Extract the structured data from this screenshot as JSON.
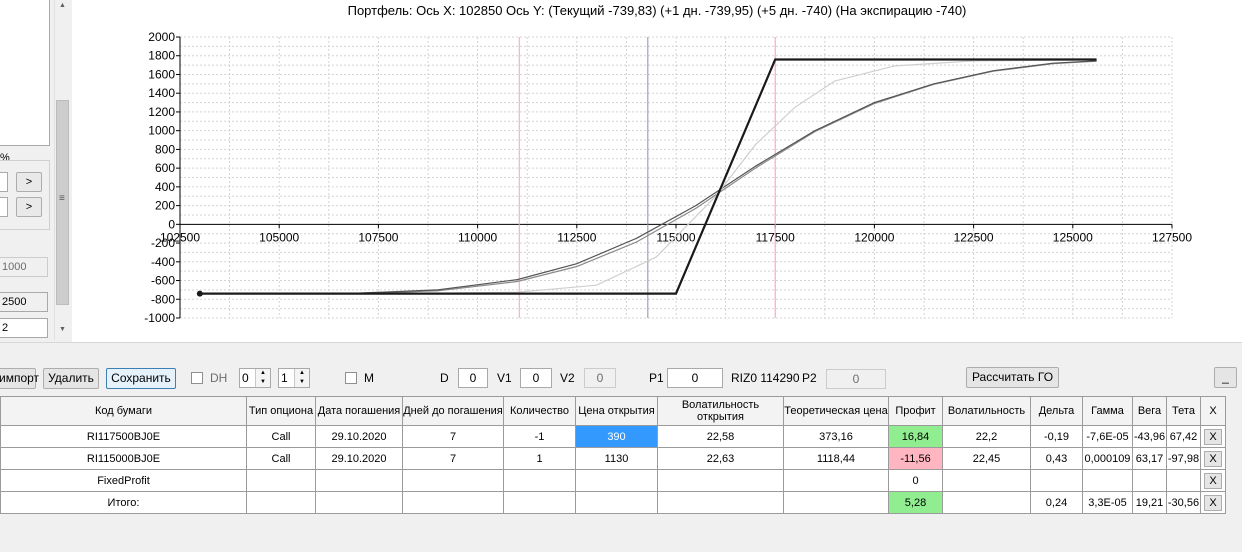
{
  "chart": {
    "title": "Портфель: Ось X: 102850 Ось Y:  (Текущий -739,83)  (+1 дн. -739,95)  (+5 дн. -740)  (На экспирацию -740)"
  },
  "chart_data": {
    "type": "line",
    "xlim": [
      102500,
      127500
    ],
    "ylim": [
      -1000,
      2000
    ],
    "x_ticks": [
      "102500",
      "105000",
      "107500",
      "110000",
      "112500",
      "115000",
      "117500",
      "120000",
      "122500",
      "125000",
      "127500"
    ],
    "y_ticks": [
      "2000",
      "1800",
      "1600",
      "1400",
      "1200",
      "1000",
      "800",
      "600",
      "400",
      "200",
      "0",
      "-200",
      "-400",
      "-600",
      "-800",
      "-1000"
    ],
    "grid": true,
    "vertical_lines": [
      {
        "x": 111050,
        "color": "#ff9fb0"
      },
      {
        "x": 114290,
        "color": "#8a8fa8"
      },
      {
        "x": 117500,
        "color": "#ff9fb0"
      }
    ],
    "series": [
      {
        "color": "#1a1a1a",
        "points": [
          [
            103000,
            -740
          ],
          [
            115000,
            -740
          ],
          [
            117500,
            1760
          ],
          [
            125600,
            1760
          ]
        ]
      },
      {
        "color": "#cfcfcf",
        "points": [
          [
            103000,
            -740
          ],
          [
            108000,
            -739
          ],
          [
            111000,
            -725
          ],
          [
            113000,
            -650
          ],
          [
            114500,
            -350
          ],
          [
            116000,
            300
          ],
          [
            117000,
            850
          ],
          [
            118000,
            1250
          ],
          [
            119000,
            1530
          ],
          [
            120500,
            1690
          ],
          [
            122500,
            1745
          ],
          [
            125600,
            1758
          ]
        ]
      },
      {
        "color": "#555555",
        "points": [
          [
            103000,
            -740
          ],
          [
            107000,
            -734
          ],
          [
            109000,
            -700
          ],
          [
            111000,
            -590
          ],
          [
            112500,
            -420
          ],
          [
            114000,
            -150
          ],
          [
            115500,
            200
          ],
          [
            117000,
            620
          ],
          [
            118500,
            1000
          ],
          [
            120000,
            1300
          ],
          [
            121500,
            1500
          ],
          [
            123000,
            1640
          ],
          [
            124500,
            1720
          ],
          [
            125600,
            1745
          ]
        ]
      },
      {
        "color": "#8a8a8a",
        "points": [
          [
            103000,
            -740
          ],
          [
            107000,
            -736
          ],
          [
            109000,
            -710
          ],
          [
            111000,
            -610
          ],
          [
            112500,
            -450
          ],
          [
            114000,
            -190
          ],
          [
            115500,
            170
          ],
          [
            117000,
            600
          ],
          [
            118500,
            990
          ],
          [
            120000,
            1290
          ],
          [
            121500,
            1495
          ],
          [
            123000,
            1635
          ],
          [
            124500,
            1715
          ],
          [
            125600,
            1742
          ]
        ]
      }
    ],
    "marker": {
      "x": 103000,
      "y": -740
    }
  },
  "left_panel": {
    "percent_label": "%",
    "btn1": ">",
    "btn2": ">",
    "field1": "1000",
    "field2": "2500",
    "field3": "2",
    "grip": "≡"
  },
  "toolbar": {
    "import_label": "импорт",
    "delete_label": "Удалить",
    "save_label": "Сохранить",
    "dh_label": "DH",
    "spin1_value": "0",
    "spin2_value": "1",
    "m_label": "M",
    "d_label": "D",
    "d_value": "0",
    "v1_label": "V1",
    "v1_value": "0",
    "v2_label": "V2",
    "v2_value": "0",
    "p1_label": "P1",
    "p1_value": "0",
    "riz_label": "RIZ0 114290",
    "p2_label": "P2",
    "p2_value": "0",
    "calc_go_label": "Рассчитать ГО",
    "minimize_label": "_"
  },
  "grid": {
    "headers": [
      "Код бумаги",
      "Тип опциона",
      "Дата погашения",
      "Дней до погашения",
      "Количество",
      "Цена открытия",
      "Волатильность открытия",
      "Теоретическая цена",
      "Профит",
      "Волатильность",
      "Дельта",
      "Гамма",
      "Вега",
      "Тета",
      "X"
    ],
    "rows": [
      {
        "code": "RI117500BJ0E",
        "type": "Call",
        "date": "29.10.2020",
        "days": "7",
        "qty": "-1",
        "open_price": "390",
        "open_vol": "22,58",
        "theor": "373,16",
        "profit": "16,84",
        "vol": "22,2",
        "delta": "-0,19",
        "gamma": "-7,6E-05",
        "vega": "-43,96",
        "theta": "67,42",
        "x": "X"
      },
      {
        "code": "RI115000BJ0E",
        "type": "Call",
        "date": "29.10.2020",
        "days": "7",
        "qty": "1",
        "open_price": "1130",
        "open_vol": "22,63",
        "theor": "1118,44",
        "profit": "-11,56",
        "vol": "22,45",
        "delta": "0,43",
        "gamma": "0,000109",
        "vega": "63,17",
        "theta": "-97,98",
        "x": "X"
      }
    ],
    "fixed": {
      "code": "FixedProfit",
      "profit": "0",
      "x": "X"
    },
    "total": {
      "code": "Итого:",
      "profit": "5,28",
      "delta": "0,24",
      "gamma": "3,3E-05",
      "vega": "19,21",
      "theta": "-30,56",
      "x": "X"
    }
  }
}
